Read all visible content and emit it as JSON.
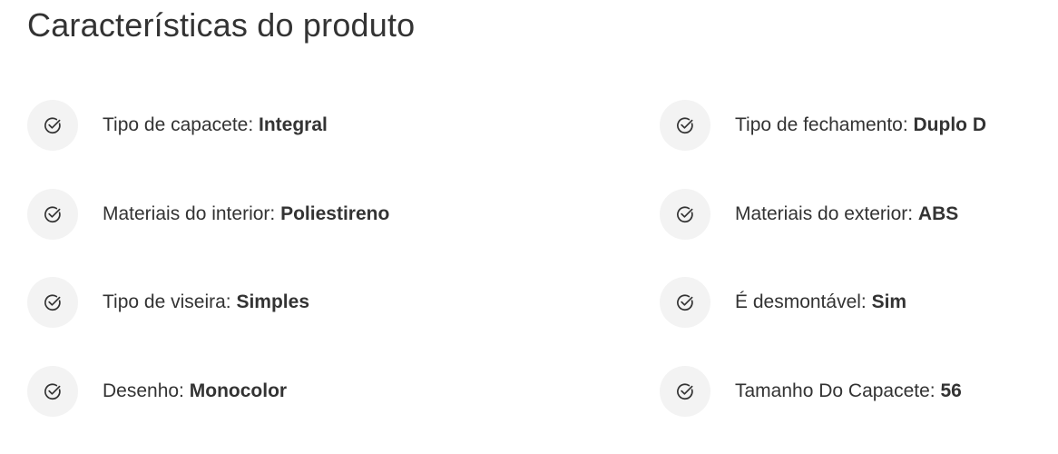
{
  "page": {
    "title": "Características do produto"
  },
  "specs": [
    {
      "label": "Tipo de capacete:",
      "value": "Integral",
      "icon": "check-circle-icon"
    },
    {
      "label": "Tipo de fechamento:",
      "value": "Duplo D",
      "icon": "check-circle-icon"
    },
    {
      "label": "Materiais do interior:",
      "value": "Poliestireno",
      "icon": "check-circle-icon"
    },
    {
      "label": "Materiais do exterior:",
      "value": "ABS",
      "icon": "check-circle-icon"
    },
    {
      "label": "Tipo de viseira:",
      "value": "Simples",
      "icon": "check-circle-icon"
    },
    {
      "label": "É desmontável:",
      "value": "Sim",
      "icon": "check-circle-icon"
    },
    {
      "label": "Desenho:",
      "value": "Monocolor",
      "icon": "check-circle-icon"
    },
    {
      "label": "Tamanho Do Capacete:",
      "value": "56",
      "icon": "check-circle-icon"
    }
  ],
  "colors": {
    "text": "#333333",
    "icon_background": "#f3f3f3",
    "icon_stroke": "#333333"
  }
}
